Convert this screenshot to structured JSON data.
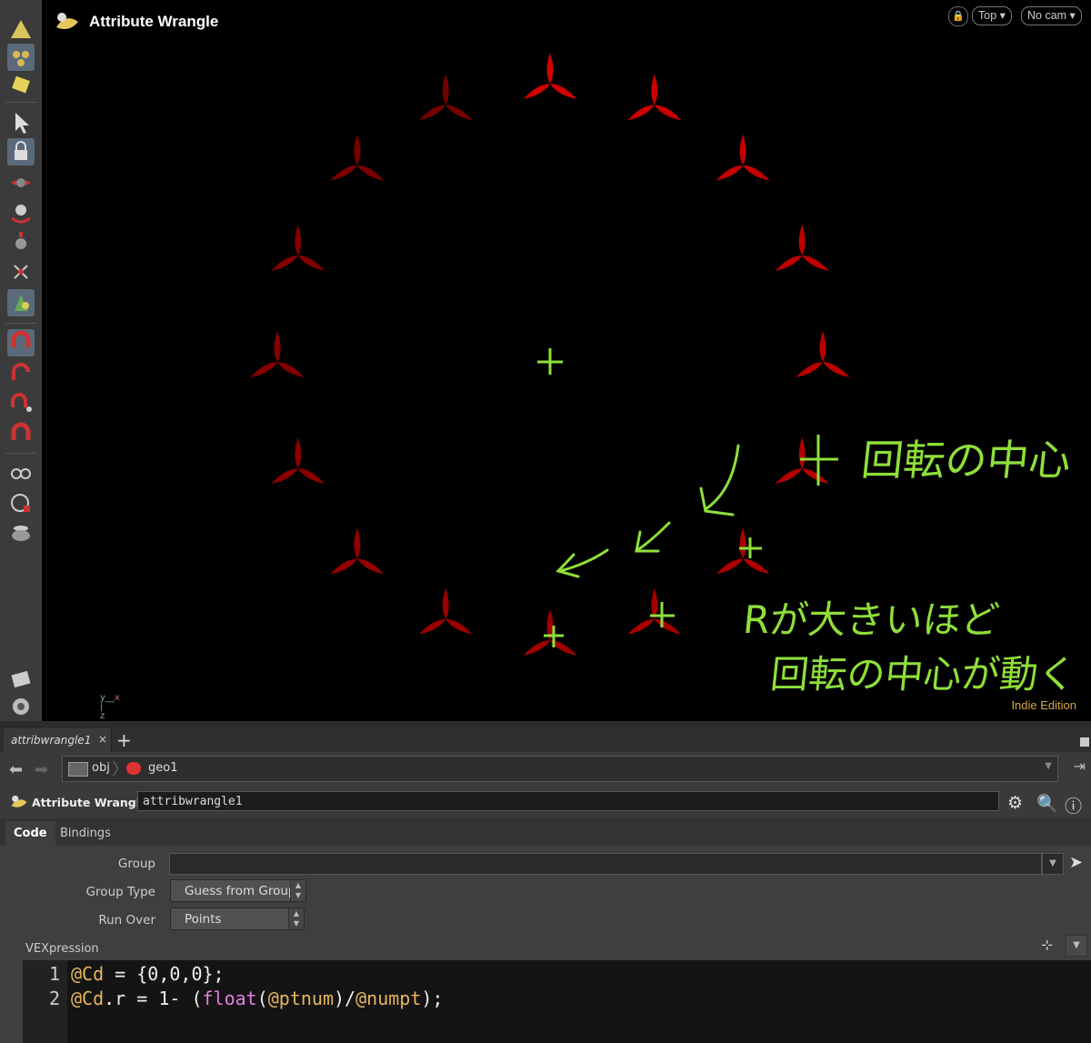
{
  "viewport": {
    "title": "Attribute Wrangle",
    "lock_icon": "lock-icon",
    "view_menu": "Top",
    "cam_menu": "No cam",
    "edition": "Indie Edition",
    "axes": {
      "y": "y",
      "x": "x",
      "z": "z"
    },
    "points_count": 16,
    "annotation_colors": {
      "points": "#cc0000",
      "handwriting": "#8fdf3a"
    },
    "annotations": {
      "label1": "回転の中心",
      "label2_line1": "Rが大きいほど",
      "label2_line2": "回転の中心が動く"
    }
  },
  "tab": {
    "label": "attribwrangle1",
    "close": "×",
    "add": "+"
  },
  "path": {
    "obj": "obj",
    "geo": "geo1"
  },
  "node": {
    "type_label": "Attribute Wrangle",
    "name": "attribwrangle1"
  },
  "param_tabs": [
    {
      "label": "Code"
    },
    {
      "label": "Bindings"
    }
  ],
  "params": {
    "group_label": "Group",
    "group_value": "",
    "group_type_label": "Group Type",
    "group_type_value": "Guess from Group",
    "run_over_label": "Run Over",
    "run_over_value": "Points",
    "vex_label": "VEXpression"
  },
  "code": {
    "line_numbers": [
      "1",
      "2"
    ],
    "line1": {
      "a": "@Cd",
      "b": " = {0,0,0};"
    },
    "line2": {
      "a": "@Cd",
      "b": ".r = 1- (",
      "f": "float",
      "c": "(",
      "d": "@ptnum",
      "e": ")/",
      "g": "@numpt",
      "h": ");"
    }
  }
}
